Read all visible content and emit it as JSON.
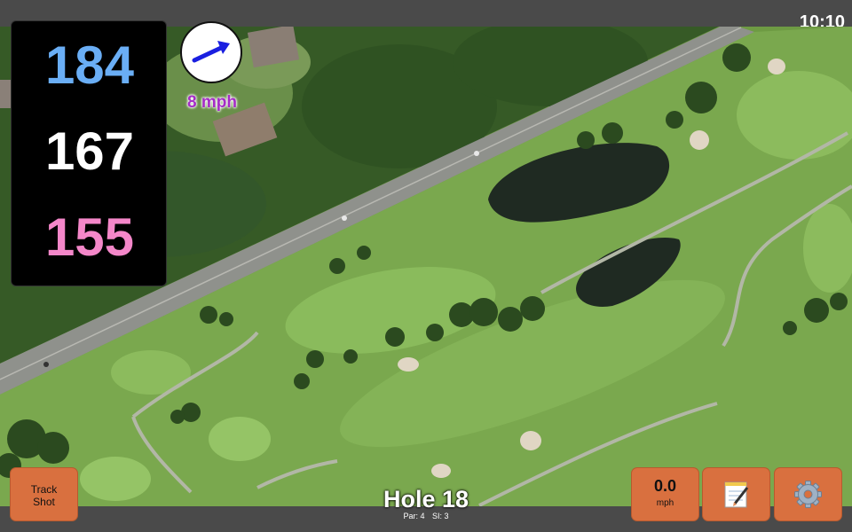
{
  "status": {
    "time": "10:10"
  },
  "distances": {
    "back": "184",
    "middle": "167",
    "front": "155"
  },
  "distance_colors": {
    "back": "#6aaef5",
    "middle": "#ffffff",
    "front": "#f487c9"
  },
  "wind": {
    "speed": "8 mph",
    "direction_icon": "arrow-right-icon"
  },
  "track_shot": {
    "label_line1": "Track",
    "label_line2": "Shot"
  },
  "speed": {
    "value": "0.0",
    "unit": "mph"
  },
  "toolbar": {
    "notes_icon": "notepad-icon",
    "settings_icon": "gear-icon",
    "button_color": "#d9703f"
  },
  "hole": {
    "title": "Hole 18",
    "par": "Par: 4",
    "si": "SI: 3"
  }
}
